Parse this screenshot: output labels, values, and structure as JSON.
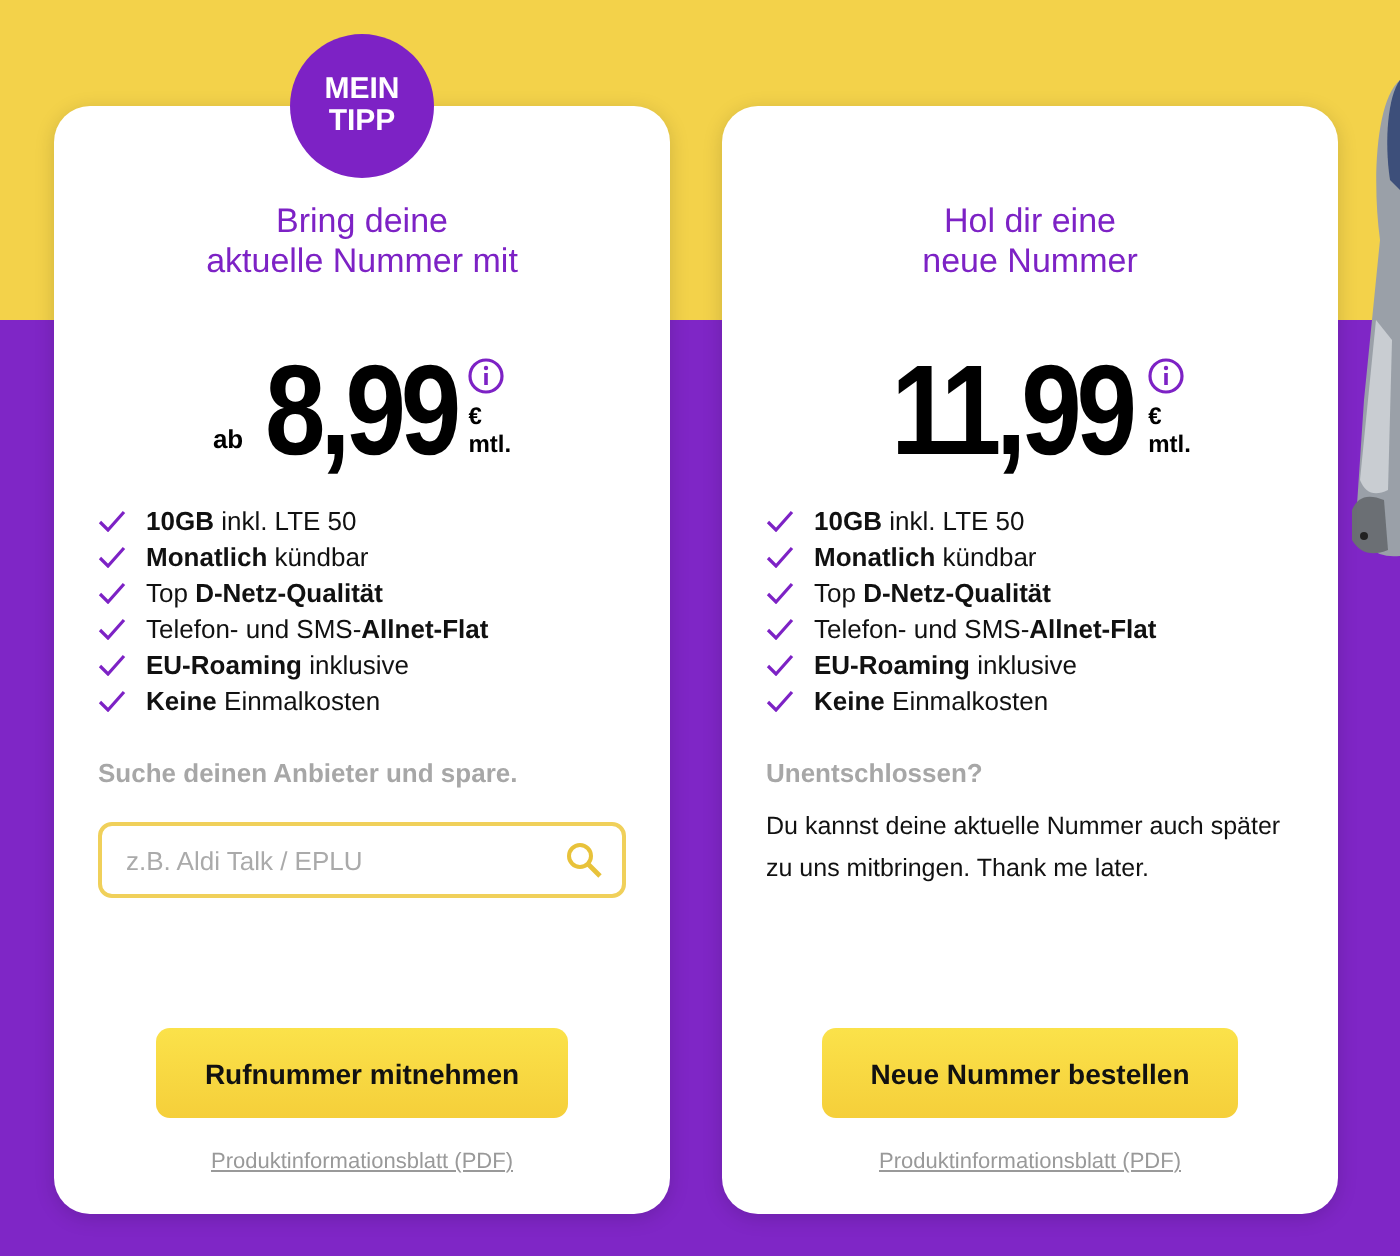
{
  "cards": [
    {
      "kind": "search",
      "badge": [
        "MEIN",
        "TIPP"
      ],
      "title": [
        "Bring deine",
        "aktuelle Nummer mit"
      ],
      "price": {
        "prefix": "ab",
        "amount": "8,99",
        "currency": "€",
        "period": "mtl."
      },
      "features": [
        "**10GB** inkl. LTE 50",
        "**Monatlich** kündbar",
        "Top **D-Netz-Qualität**",
        "Telefon- und SMS-**Allnet-Flat**",
        "**EU-Roaming** inklusive",
        "**Keine** Einmalkosten"
      ],
      "search": {
        "label": "Suche deinen Anbieter und spare.",
        "placeholder": "z.B. Aldi Talk / EPLU"
      },
      "button": "Rufnummer mitnehmen",
      "link": "Produktinformationsblatt (PDF)"
    },
    {
      "kind": "info",
      "title": [
        "Hol dir eine",
        "neue Nummer"
      ],
      "price": {
        "amount": "11,99",
        "currency": "€",
        "period": "mtl."
      },
      "features": [
        "**10GB** inkl. LTE 50",
        "**Monatlich** kündbar",
        "Top **D-Netz-Qualität**",
        "Telefon- und SMS-**Allnet-Flat**",
        "**EU-Roaming** inklusive",
        "**Keine** Einmalkosten"
      ],
      "info": {
        "heading": "Unentschlossen?",
        "text": "Du kannst deine aktuelle Nummer auch später zu uns mitbringen. Thank me later."
      },
      "button": "Neue Nummer bestellen",
      "link": "Produktinformationsblatt (PDF)"
    }
  ]
}
